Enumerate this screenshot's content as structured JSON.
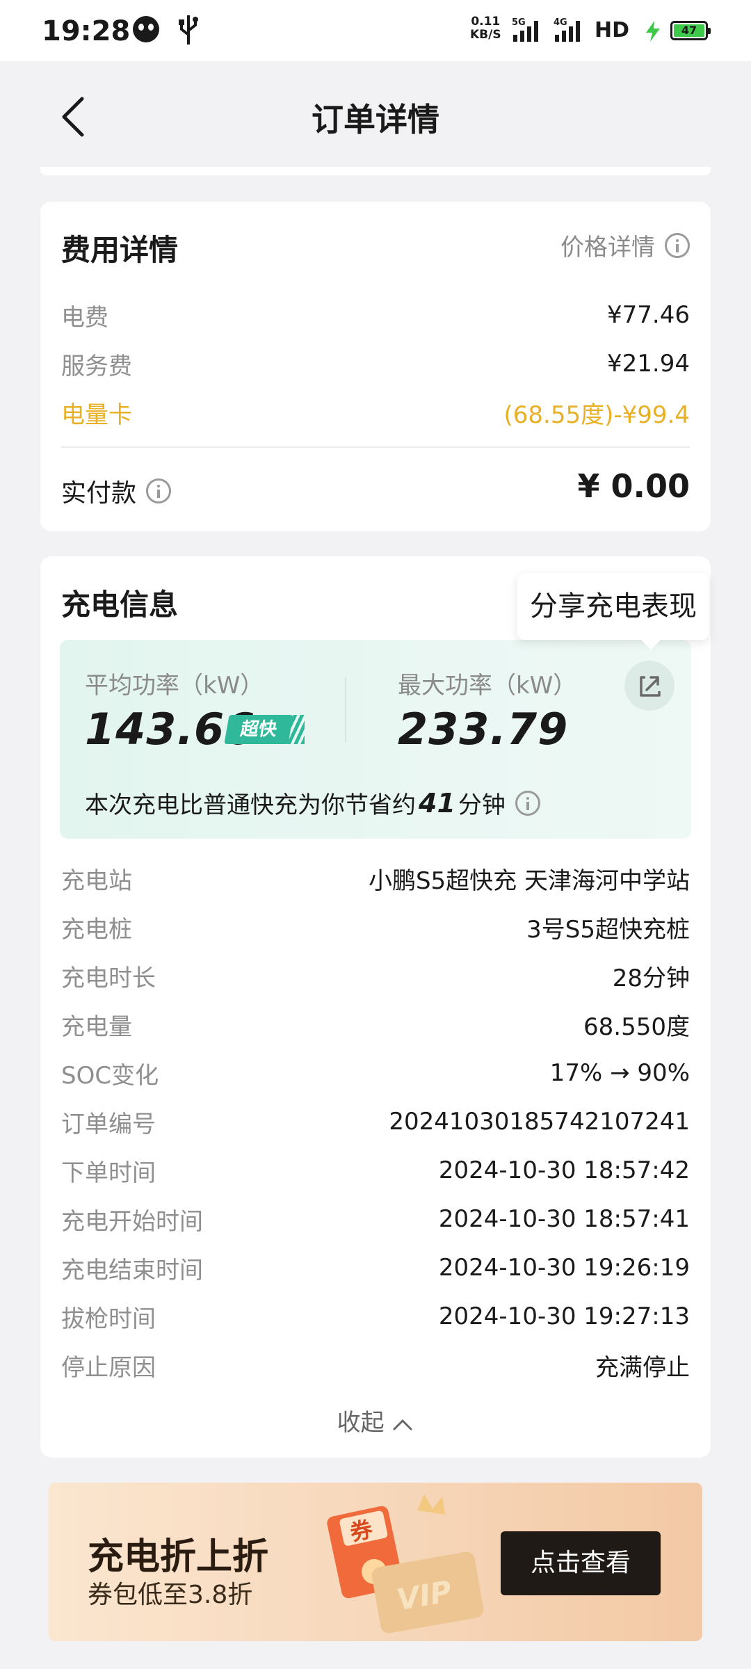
{
  "status_bar": {
    "time": "19:28",
    "speed_value": "0.11",
    "speed_unit": "KB/S",
    "net1": "5G",
    "net2": "4G",
    "hd": "HD",
    "battery": "47"
  },
  "header": {
    "title": "订单详情"
  },
  "fee": {
    "title": "费用详情",
    "price_detail_label": "价格详情",
    "rows": [
      {
        "label": "电费",
        "value": "¥77.46"
      },
      {
        "label": "服务费",
        "value": "¥21.94"
      },
      {
        "label": "电量卡",
        "value": "(68.55度)-¥99.4"
      }
    ],
    "paid_label": "实付款",
    "paid_value": "¥ 0.00",
    "highlight_color": "#e8b024"
  },
  "charge": {
    "title": "充电信息",
    "share_tooltip": "分享充电表现",
    "avg_power_label": "平均功率（kW）",
    "avg_power_value": "143.66",
    "fast_badge": "超快",
    "max_power_label": "最大功率（kW）",
    "max_power_value": "233.79",
    "save_prefix": "本次充电比普通快充为你节省约",
    "save_minutes": "41",
    "save_suffix": "分钟",
    "details": [
      {
        "label": "充电站",
        "value": "小鹏S5超快充 天津海河中学站"
      },
      {
        "label": "充电桩",
        "value": "3号S5超快充桩"
      },
      {
        "label": "充电时长",
        "value": "28分钟"
      },
      {
        "label": "充电量",
        "value": "68.550度"
      },
      {
        "label": "SOC变化",
        "value": "17% → 90%"
      },
      {
        "label": "订单编号",
        "value": "20241030185742107241"
      },
      {
        "label": "下单时间",
        "value": "2024-10-30 18:57:42"
      },
      {
        "label": "充电开始时间",
        "value": "2024-10-30 18:57:41"
      },
      {
        "label": "充电结束时间",
        "value": "2024-10-30 19:26:19"
      },
      {
        "label": "拔枪时间",
        "value": "2024-10-30 19:27:13"
      },
      {
        "label": "停止原因",
        "value": "充满停止"
      }
    ],
    "collapse_label": "收起"
  },
  "promo": {
    "title": "充电折上折",
    "subtitle": "券包低至3.8折",
    "cta": "点击查看",
    "coupon_text": "券",
    "vip_text": "VIP"
  }
}
